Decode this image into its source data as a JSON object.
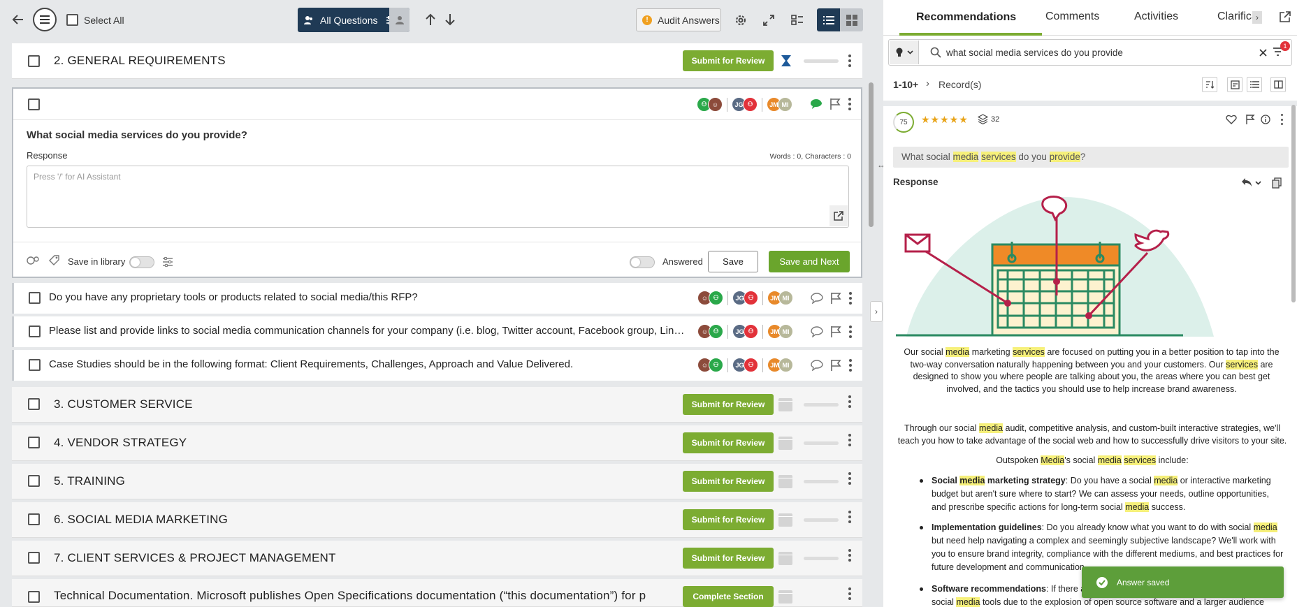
{
  "toolbar": {
    "select_all": "Select All",
    "filter_label": "All Questions",
    "audit_label": "Audit Answers"
  },
  "sections": [
    {
      "num_title": "2. GENERAL REQUIREMENTS",
      "button": "Submit for Review"
    },
    {
      "num_title": "3. CUSTOMER SERVICE",
      "button": "Submit for Review"
    },
    {
      "num_title": "4. VENDOR STRATEGY",
      "button": "Submit for Review"
    },
    {
      "num_title": "5. TRAINING",
      "button": "Submit for Review"
    },
    {
      "num_title": "6. SOCIAL MEDIA MARKETING",
      "button": "Submit for Review"
    },
    {
      "num_title": "7. CLIENT SERVICES & PROJECT MANAGEMENT",
      "button": "Submit for Review"
    },
    {
      "num_title": "Technical Documentation. Microsoft publishes Open Specifications documentation (“this documentation”) for p",
      "button": "Complete Section"
    }
  ],
  "active_question": {
    "text": "What social media services do you provide?",
    "response_label": "Response",
    "counter": "Words : 0, Characters : 0",
    "placeholder": "Press '/' for AI Assistant",
    "save_in_library": "Save in library",
    "answered": "Answered",
    "save": "Save",
    "save_next": "Save and Next",
    "avatars_b": "JG",
    "avatars_c": "JM",
    "avatars_d": "MI"
  },
  "questions": [
    {
      "text": "Do you have any proprietary tools or products related to social media/this RFP?",
      "a": "JG",
      "b": "JM",
      "c": "MI"
    },
    {
      "text": "Please list and provide links to social media communication channels for your company (i.e. blog, Twitter account, Facebook group, LinkedIn profile, etc.)",
      "a": "JG",
      "b": "JM",
      "c": "MI"
    },
    {
      "text": "Case Studies should be in the following format: Client Requirements, Challenges, Approach and Value Delivered.",
      "a": "JG",
      "b": "JM",
      "c": "MI"
    }
  ],
  "right": {
    "tabs": [
      "Recommendations",
      "Comments",
      "Activities",
      "Clarifications"
    ],
    "search_value": "what social media services do you provide",
    "filter_badge": "1",
    "range": "1-10+",
    "records": "Record(s)",
    "score": "75",
    "stars": "★★★★★",
    "layers": "32",
    "question": {
      "p1": "What social ",
      "h1": "media",
      "p2": " ",
      "h2": "services",
      "p3": " do you ",
      "h3": "provide",
      "p4": "?"
    },
    "response_label": "Response",
    "para1": {
      "a": "Our social ",
      "h1": "media",
      "b": " marketing ",
      "h2": "services",
      "c": " are focused on putting you in a better position to tap into the two-way conversation naturally happening between you and your customers. Our ",
      "h3": "services",
      "d": " are designed to show you where people are talking about you, the areas where you can best get involved, and the tactics you should use to help increase brand awareness."
    },
    "para2": {
      "a": "Through our social ",
      "h1": "media",
      "b": " audit, competitive analysis, and custom-built interactive strategies, we'll teach you how to take advantage of the social web and how to successfully drive visitors to your site."
    },
    "para3": {
      "a": "Outspoken ",
      "h1": "Media",
      "b": "'s social ",
      "h2": "media",
      "c": " ",
      "h3": "services",
      "d": " include:"
    },
    "bullets": [
      {
        "bold_a": "Social ",
        "bold_h": "media",
        "bold_b": " marketing strategy",
        "t1": ": Do you have a social ",
        "h1": "media",
        "t2": " or interactive marketing budget but aren't sure where to start? We can assess your needs, outline opportunities, and prescribe specific actions for long-term social ",
        "h2": "media",
        "t3": " success."
      },
      {
        "bold_a": "Implementation guidelines",
        "t1": ": Do you already know what you want to do with social ",
        "h1": "media",
        "t2": " but need help navigating a complex and seemingly subjective landscape? We'll work with you to ensure brand integrity, compliance with the different mediums, and best practices for future development and communication."
      },
      {
        "bold_a": "Software recommendations",
        "t1": ": If there are",
        "t2": "social ",
        "h1": "media",
        "t3": " tools due to the explosion of open source software and a larger audience"
      }
    ],
    "toast": "Answer saved"
  }
}
